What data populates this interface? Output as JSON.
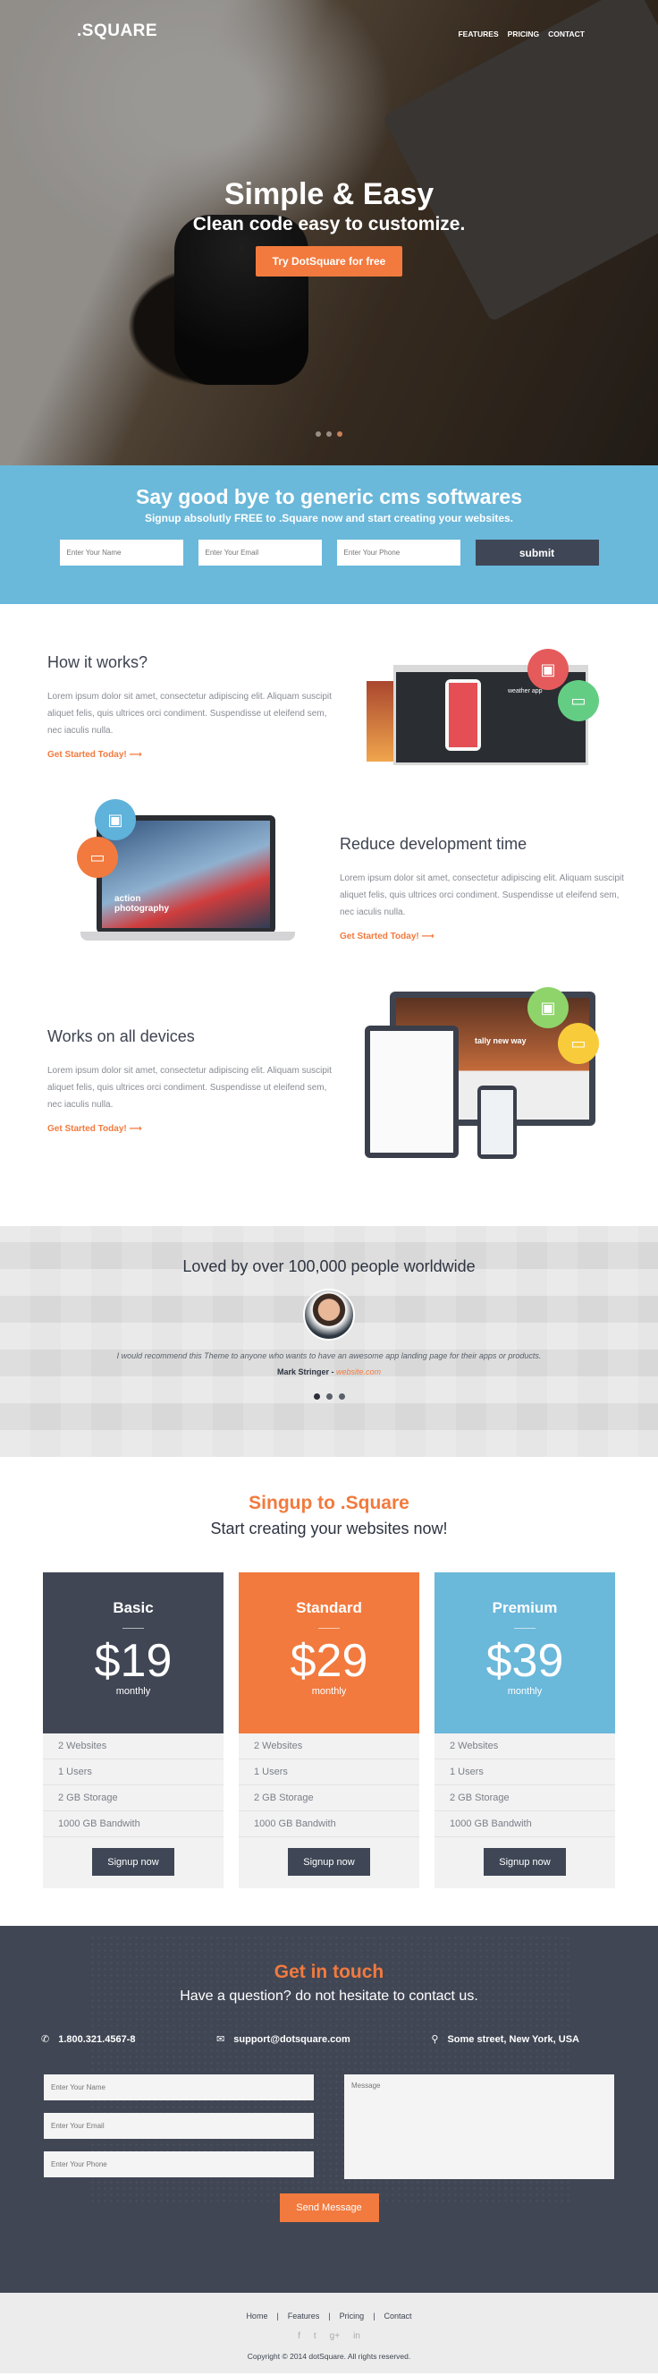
{
  "brand": ".SQUARE",
  "nav": [
    "FEATURES",
    "PRICING",
    "CONTACT"
  ],
  "hero": {
    "title": "Simple & Easy",
    "subtitle": "Clean code easy to customize.",
    "cta": "Try DotSquare for free"
  },
  "signup": {
    "title": "Say good bye to generic cms softwares",
    "subtitle": "Signup absolutly FREE to .Square now and start creating your websites.",
    "name_placeholder": "Enter Your Name",
    "email_placeholder": "Enter Your Email",
    "phone_placeholder": "Enter Your Phone",
    "submit": "submit"
  },
  "features": [
    {
      "title": "How it works?",
      "body": "Lorem ipsum dolor sit amet, consectetur adipiscing elit. Aliquam suscipit aliquet felis, quis ultrices orci condiment. Suspendisse ut eleifend sem, nec iaculis nulla.",
      "link": "Get Started Today! ⟶"
    },
    {
      "title": "Reduce development time",
      "body": "Lorem ipsum dolor sit amet, consectetur adipiscing elit. Aliquam suscipit aliquet felis, quis ultrices orci condiment. Suspendisse ut eleifend sem, nec iaculis nulla.",
      "link": "Get Started Today! ⟶"
    },
    {
      "title": "Works on all devices",
      "body": "Lorem ipsum dolor sit amet, consectetur adipiscing elit. Aliquam suscipit aliquet felis, quis ultrices orci condiment. Suspendisse ut eleifend sem, nec iaculis nulla.",
      "link": "Get Started Today! ⟶"
    }
  ],
  "mockup_text": {
    "weather": "weather app",
    "action": "action photography",
    "tally": "tally new way"
  },
  "testimonial": {
    "title": "Loved by over 100,000 people worldwide",
    "quote": "I would recommend this Theme to anyone who wants to have an awesome app landing page for their apps or products.",
    "author": "Mark Stringer - ",
    "website": "website.com"
  },
  "pricing": {
    "title": "Singup to .Square",
    "subtitle": "Start creating your websites now!",
    "plans": [
      {
        "name": "Basic",
        "price": "$19",
        "period": "monthly",
        "color": "#404654",
        "features": [
          "2 Websites",
          "1 Users",
          "2 GB Storage",
          "1000 GB Bandwith"
        ],
        "button": "Signup now"
      },
      {
        "name": "Standard",
        "price": "$29",
        "period": "monthly",
        "color": "#f27a3e",
        "features": [
          "2 Websites",
          "1 Users",
          "2 GB Storage",
          "1000 GB Bandwith"
        ],
        "button": "Signup now"
      },
      {
        "name": "Premium",
        "price": "$39",
        "period": "monthly",
        "color": "#6ab8da",
        "features": [
          "2 Websites",
          "1 Users",
          "2 GB Storage",
          "1000 GB Bandwith"
        ],
        "button": "Signup now"
      }
    ]
  },
  "contact": {
    "title": "Get in touch",
    "subtitle": "Have a question? do not hesitate to contact us.",
    "phone": "1.800.321.4567-8",
    "email": "support@dotsquare.com",
    "address": "Some street, New York, USA",
    "name_placeholder": "Enter Your Name",
    "email_placeholder": "Enter Your Email",
    "phone_placeholder": "Enter Your Phone",
    "message_placeholder": "Message",
    "send": "Send Message"
  },
  "footer": {
    "links": [
      "Home",
      "Features",
      "Pricing",
      "Contact"
    ],
    "copyright": "Copyright © 2014 dotSquare. All rights reserved."
  },
  "colors": {
    "accent": "#f27a3e",
    "dark": "#404654",
    "blue": "#6ab8da"
  }
}
